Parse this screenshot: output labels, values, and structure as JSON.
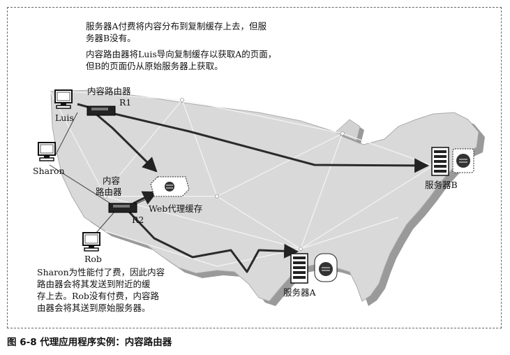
{
  "notes": {
    "top_line1": "服务器A付费将内容分布到复制缓存上去，但服",
    "top_line2": "务器B没有。",
    "top_line3": "内容路由器将Luis导向复制缓存以获取A的页面，",
    "top_line4": "但B的页面仍从原始服务器上获取。",
    "bottom_line1": "Sharon为性能付了费，因此内容",
    "bottom_line2": "路由器会将其发送到附近的缓",
    "bottom_line3": "存上去。Rob没有付费，内容路",
    "bottom_line4": "由器会将其送到原始服务器。"
  },
  "labels": {
    "router_r1_title": "内容路由器",
    "r1": "R1",
    "luis": "Luis",
    "sharon": "Sharon",
    "rob": "Rob",
    "router_r2_title_line1": "内容",
    "router_r2_title_line2": "路由器",
    "r2": "R2",
    "web_proxy_cache": "Web代理缓存",
    "server_a": "服务器A",
    "server_b": "服务器B"
  },
  "caption": "图 6-8   代理应用程序实例：内容路由器",
  "icons": {
    "computer": "computer-icon",
    "router": "router-icon",
    "server": "server-tower-icon",
    "cache": "cache-icon"
  }
}
